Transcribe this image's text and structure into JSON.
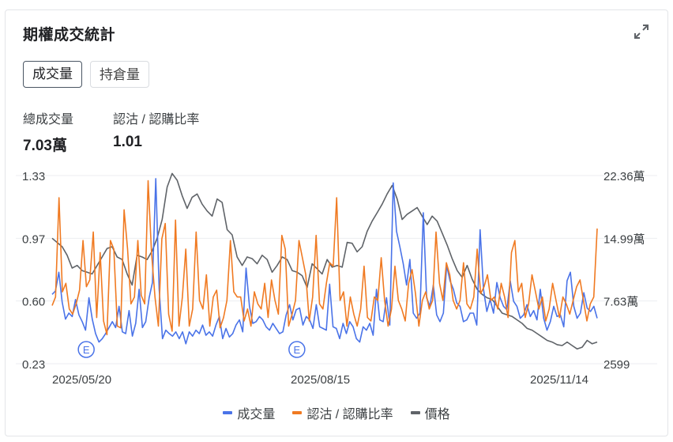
{
  "card": {
    "title": "期權成交統計",
    "expand_icon": "expand-icon"
  },
  "tabs": [
    {
      "label": "成交量",
      "active": true
    },
    {
      "label": "持倉量",
      "active": false
    }
  ],
  "stats": {
    "total_volume_label": "總成交量",
    "total_volume_value": "7.03萬",
    "ratio_label": "認沽 / 認購比率",
    "ratio_value": "1.01"
  },
  "colors": {
    "volume": "#4a73e8",
    "ratio": "#f07a22",
    "price": "#5f6368",
    "grid": "#eceef0"
  },
  "chart_data": {
    "type": "line",
    "x_tick_labels": [
      "2025/05/20",
      "2025/08/15",
      "2025/11/14"
    ],
    "left_axis": {
      "ticks": [
        "1.33",
        "0.97",
        "0.60",
        "0.23"
      ],
      "ylim": [
        0.23,
        1.33
      ]
    },
    "right_axis": {
      "ticks": [
        "22.36萬",
        "14.99萬",
        "7.63萬",
        "2599"
      ],
      "ylim": [
        2599,
        223600
      ]
    },
    "event_markers": [
      {
        "label": "E",
        "index": 5
      },
      {
        "label": "E",
        "index": 68
      }
    ],
    "grid": true,
    "legend_position": "bottom",
    "series": [
      {
        "name": "成交量",
        "axis": "right",
        "values": [
          84000,
          88000,
          110000,
          75000,
          55000,
          62000,
          58000,
          78000,
          60000,
          52000,
          42000,
          80000,
          55000,
          38000,
          28000,
          32000,
          38000,
          45000,
          52000,
          45000,
          70000,
          40000,
          38000,
          65000,
          35000,
          50000,
          90000,
          45000,
          52000,
          80000,
          98000,
          220000,
          90000,
          32000,
          42000,
          38000,
          35000,
          40000,
          32000,
          40000,
          26000,
          40000,
          35000,
          42000,
          38000,
          48000,
          36000,
          40000,
          35000,
          48000,
          58000,
          32000,
          44000,
          34000,
          38000,
          48000,
          54000,
          40000,
          115000,
          70000,
          50000,
          52000,
          58000,
          54000,
          46000,
          42000,
          50000,
          44000,
          38000,
          40000,
          60000,
          72000,
          54000,
          66000,
          68000,
          48000,
          58000,
          54000,
          44000,
          72000,
          46000,
          44000,
          42000,
          96000,
          46000,
          44000,
          32000,
          50000,
          38000,
          52000,
          46000,
          32000,
          28000,
          46000,
          42000,
          50000,
          36000,
          90000,
          54000,
          52000,
          80000,
          48000,
          215000,
          158000,
          140000,
          120000,
          95000,
          125000,
          62000,
          56000,
          62000,
          180000,
          80000,
          70000,
          95000,
          60000,
          52000,
          62000,
          118000,
          100000,
          90000,
          74000,
          70000,
          52000,
          54000,
          62000,
          62000,
          48000,
          160000,
          90000,
          64000,
          78000,
          62000,
          98000,
          80000,
          70000,
          66000,
          100000,
          76000,
          70000,
          56000,
          60000,
          72000,
          58000,
          65000,
          54000,
          90000,
          56000,
          42000,
          52000,
          70000,
          58000,
          60000,
          46000,
          100000,
          110000,
          70000,
          56000,
          62000,
          86000,
          68000,
          64000,
          70000,
          56000
        ],
        "note": ""
      }
    ]
  }
}
